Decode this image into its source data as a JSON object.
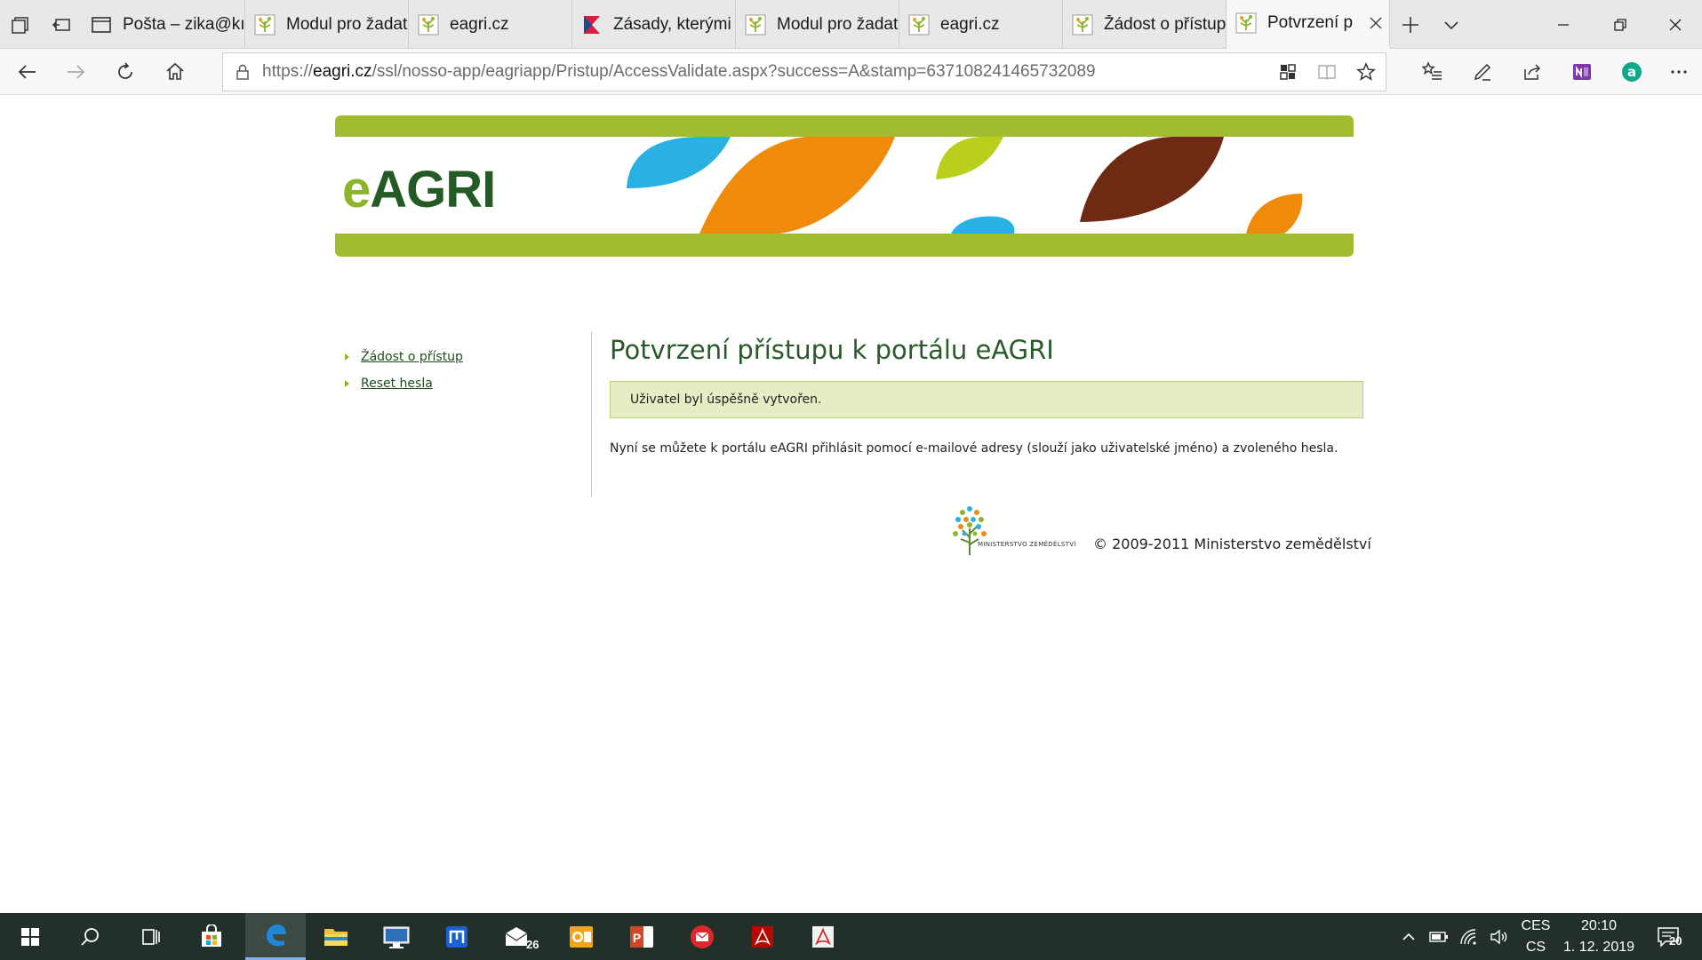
{
  "browser": {
    "tabs": [
      {
        "label": "Pošta – zika@kı",
        "favicon": "mail-window-icon",
        "active": false
      },
      {
        "label": "Modul pro žadate",
        "favicon": "eagri-favicon",
        "active": false
      },
      {
        "label": "eagri.cz",
        "favicon": "eagri-favicon",
        "active": false
      },
      {
        "label": "Zásady, kterými",
        "favicon": "red-flag-favicon",
        "active": false
      },
      {
        "label": "Modul pro žadate",
        "favicon": "eagri-favicon",
        "active": false
      },
      {
        "label": "eagri.cz",
        "favicon": "eagri-favicon",
        "active": false
      },
      {
        "label": "Žádost o přístup",
        "favicon": "eagri-favicon",
        "active": false
      },
      {
        "label": "Potvrzení p",
        "favicon": "eagri-favicon",
        "active": true
      }
    ],
    "url": {
      "prefix": "https://",
      "host": "eagri.cz",
      "path": "/ssl/nosso-app/eagriapp/Pristup/AccessValidate.aspx?success=A&stamp=637108241465732089"
    }
  },
  "page": {
    "logo_text_e": "e",
    "logo_text_rest": "AGRI",
    "sidebar": {
      "items": [
        {
          "label": "Žádost o přístup"
        },
        {
          "label": "Reset hesla"
        }
      ]
    },
    "title": "Potvrzení přístupu k portálu eAGRI",
    "success_message": "Uživatel byl úspěšně vytvořen.",
    "info_text": "Nyní se můžete k portálu eAGRI přihlásit pomocí e-mailové adresy (slouží jako uživatelské jméno) a zvoleného hesla.",
    "footer": {
      "ministry_logo_label": "MINISTERSTVO ZEMĚDĚLSTVÍ",
      "copyright": "© 2009-2011 Ministerstvo zemědělství"
    }
  },
  "taskbar": {
    "mail_badge": "26",
    "language_top": "CES",
    "language_bottom": "CS",
    "time": "20:10",
    "date": "1. 12. 2019",
    "notifications": "20"
  },
  "colors": {
    "banner_green": "#9fbd2f",
    "title_green": "#2a5a2a",
    "success_bg": "#e4edc4",
    "taskbar_bg": "#23302a"
  }
}
